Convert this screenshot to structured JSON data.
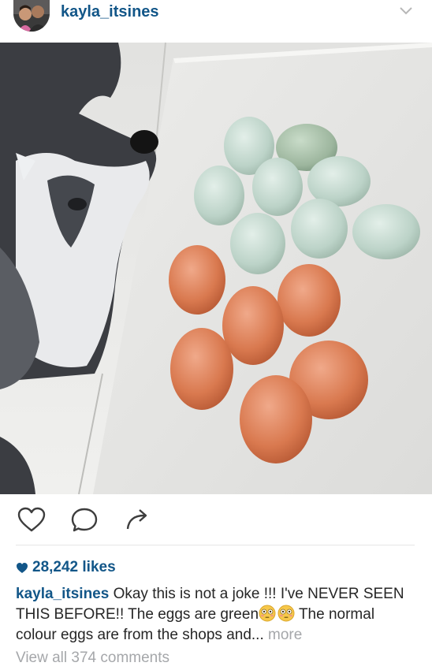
{
  "post": {
    "author": "kayla_itsines",
    "likes": "28,242 likes",
    "caption": {
      "username": "kayla_itsines",
      "text_part1": " Okay this is not a joke !!! I've NEVER SEEN THIS BEFORE!! The eggs are green",
      "text_part2": " The normal colour eggs are from the shops and... ",
      "more": "more"
    },
    "view_comments": "View all 374 comments"
  },
  "icons": {
    "options": "chevron-down-icon",
    "like": "heart-outline-icon",
    "comment": "speech-bubble-icon",
    "share": "share-arrow-icon",
    "likes_badge": "heart-filled-icon",
    "emoji": "flushed-face-emoji"
  },
  "colors": {
    "username": "#125688",
    "text": "#262626",
    "muted": "#a5a7aa",
    "divider": "#e6e6e6"
  }
}
